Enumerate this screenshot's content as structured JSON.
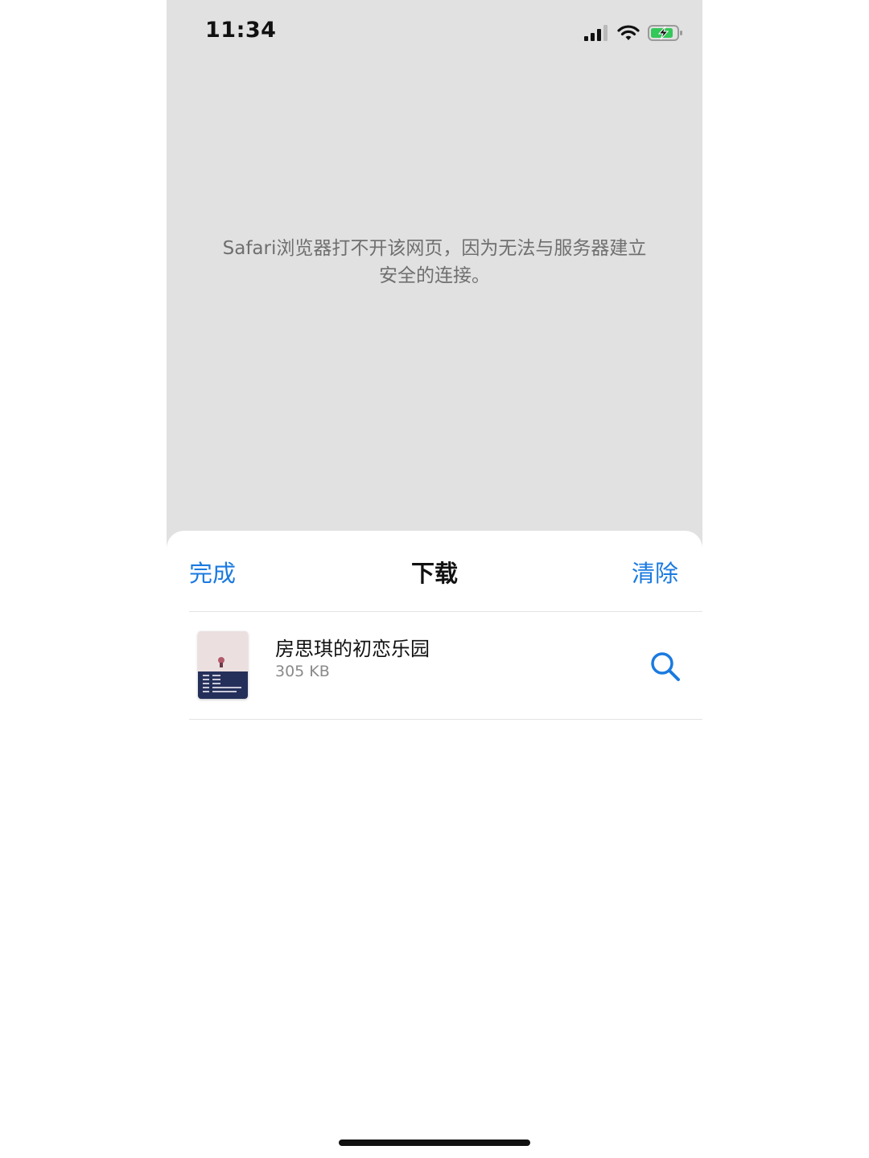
{
  "status_bar": {
    "time": "11:34"
  },
  "browser": {
    "error_message": "Safari浏览器打不开该网页，因为无法与服务器建立安全的连接。"
  },
  "downloads_sheet": {
    "done_label": "完成",
    "title": "下载",
    "clear_label": "清除",
    "items": [
      {
        "name": "房思琪的初恋乐园",
        "size": "305 KB",
        "action_icon": "search-icon"
      }
    ]
  },
  "colors": {
    "accent": "#1a7ae0",
    "page_background": "#e1e1e1",
    "battery_charging": "#34c759"
  }
}
